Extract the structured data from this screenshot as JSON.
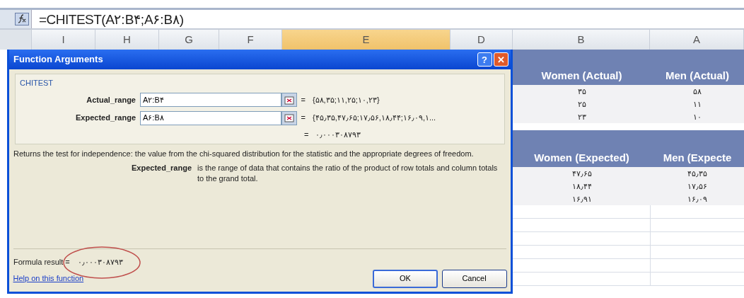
{
  "formula_bar": {
    "formula": "=CHITEST(A۲:B۴;A۶:B۸)"
  },
  "column_headers": [
    {
      "label": "A",
      "selected": false
    },
    {
      "label": "B",
      "selected": false
    },
    {
      "label": "D",
      "selected": false
    },
    {
      "label": "E",
      "selected": true
    },
    {
      "label": "F",
      "selected": false
    },
    {
      "label": "G",
      "selected": false
    },
    {
      "label": "H",
      "selected": false
    },
    {
      "label": "I",
      "selected": false
    }
  ],
  "dialog": {
    "title": "Function Arguments",
    "title_buttons": [
      {
        "kind": "close",
        "label": "✕"
      },
      {
        "kind": "help",
        "label": "?"
      }
    ],
    "function_name": "CHITEST",
    "arguments": [
      {
        "label": "Actual_range",
        "value": "A۲:B۴",
        "equals": "=",
        "result": "{۵۸,۳۵;۱۱,۲۵;۱۰,۲۳}"
      },
      {
        "label": "Expected_range",
        "value": "A۶:B۸",
        "equals": "=",
        "result": "{۴۵٫۳۵,۴۷٫۶۵;۱۷٫۵۶,۱۸٫۴۴;۱۶٫۰۹,۱..."
      }
    ],
    "function_result": {
      "equals": "=",
      "value": "۰٫۰۰۰۳۰۸۷۹۳"
    },
    "description": "Returns the test for independence: the value from the chi-squared distribution for the statistic and the appropriate degrees of freedom.",
    "argument_help": {
      "label": "Expected_range",
      "text": "is the range of data that contains the ratio of the product of row totals and column totals to the grand total."
    },
    "formula_result_label": "Formula result =",
    "formula_result": "۰٫۰۰۰۳۰۸۷۹۳",
    "help_link": "Help on this function",
    "buttons": [
      {
        "kind": "cancel",
        "label": "Cancel"
      },
      {
        "kind": "ok",
        "label": "OK"
      }
    ]
  },
  "sheet": {
    "sections": [
      {
        "headers": [
          "Men (Actual)",
          "Women (Actual)"
        ],
        "rows": [
          [
            "۵۸",
            "۳۵"
          ],
          [
            "۱۱",
            "۲۵"
          ],
          [
            "۱۰",
            "۲۳"
          ]
        ]
      },
      {
        "headers": [
          "Men (Expecte",
          "Women (Expected)"
        ],
        "rows": [
          [
            "۴۵٫۳۵",
            "۴۷٫۶۵"
          ],
          [
            "۱۷٫۵۶",
            "۱۸٫۴۴"
          ],
          [
            "۱۶٫۰۹",
            "۱۶٫۹۱"
          ]
        ]
      }
    ]
  }
}
